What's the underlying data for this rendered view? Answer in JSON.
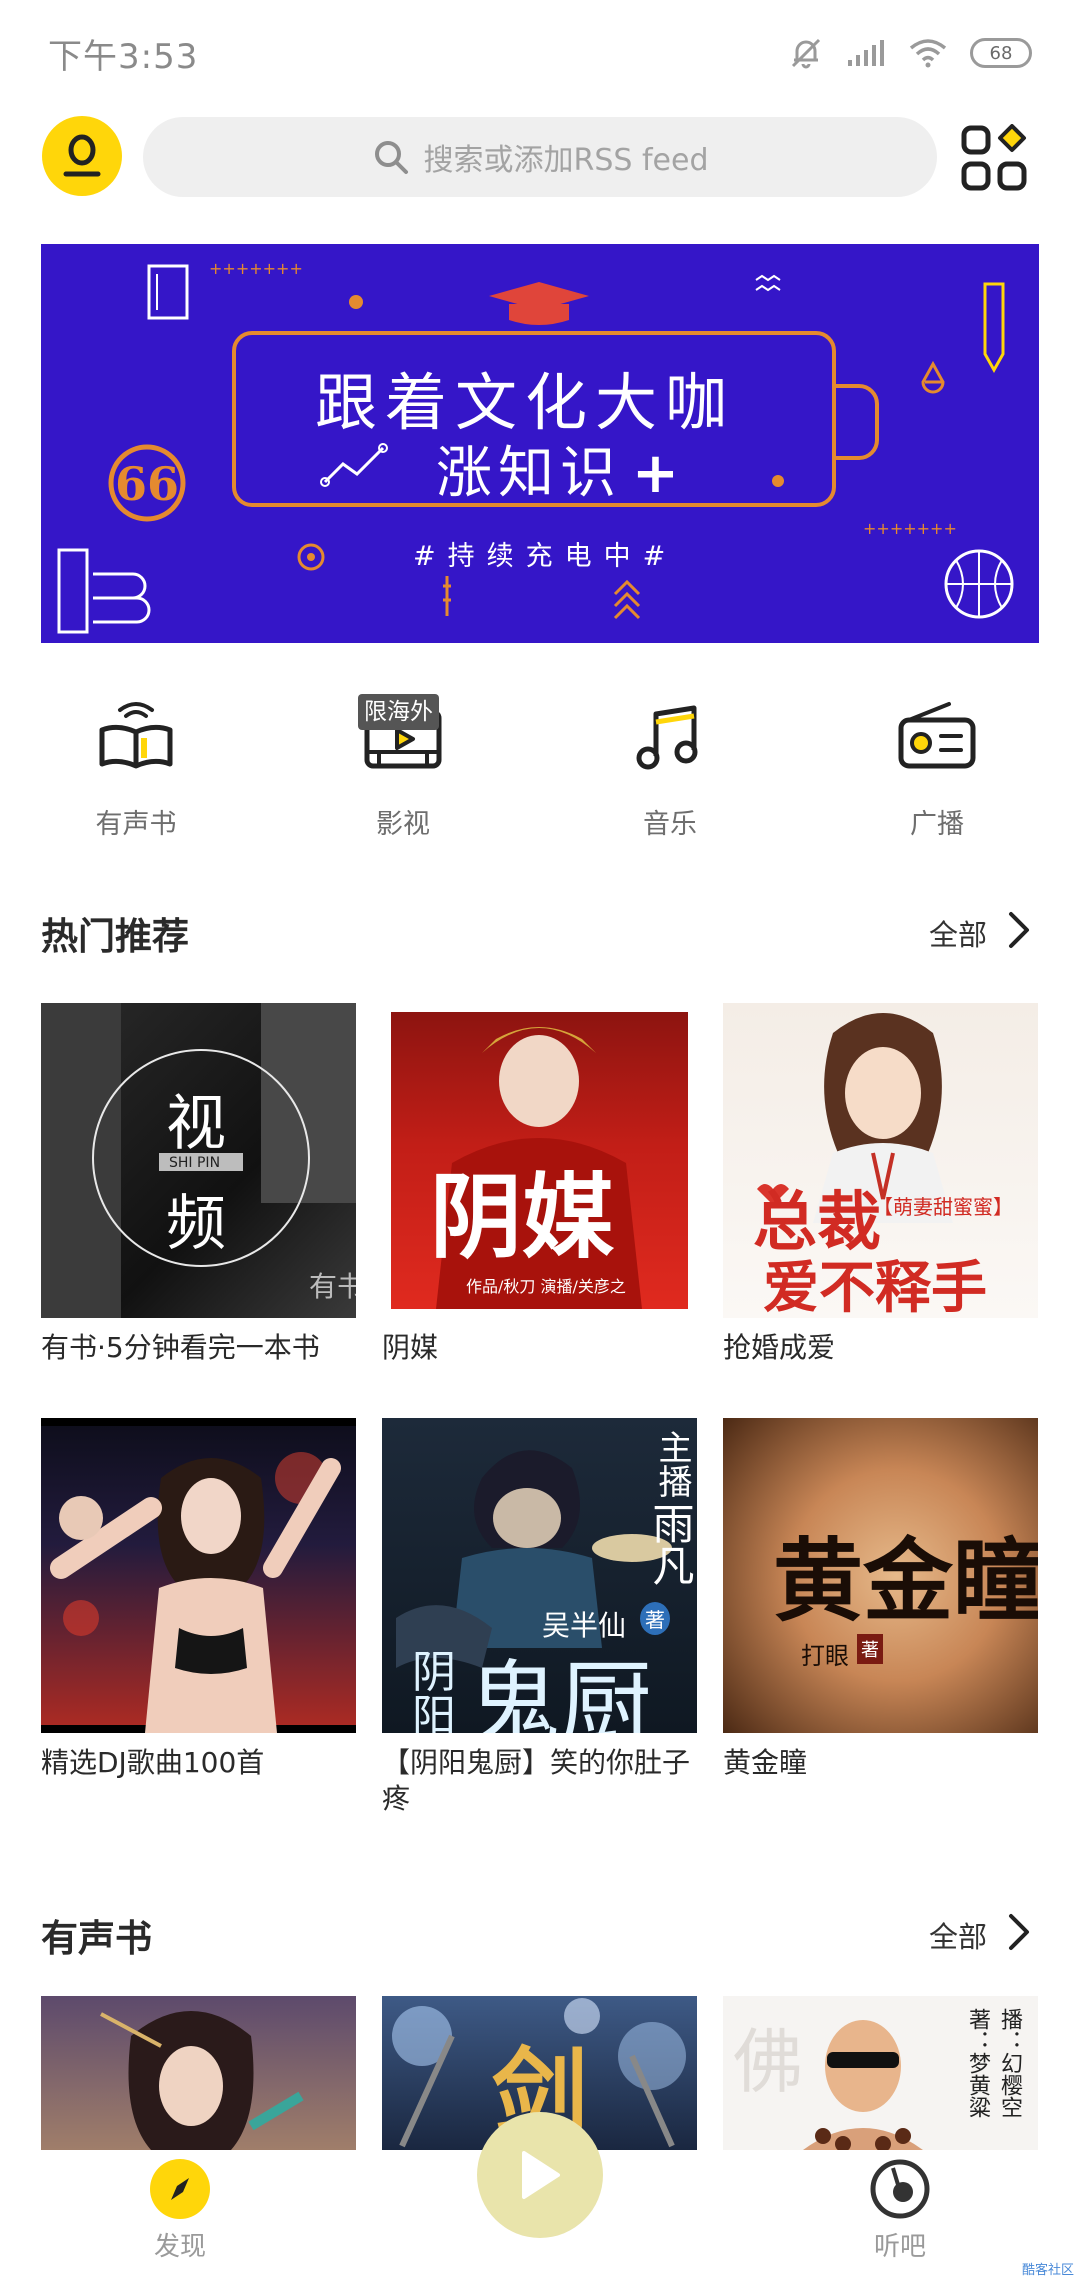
{
  "status_bar": {
    "time": "下午3:53",
    "battery": "68"
  },
  "search": {
    "placeholder": "搜索或添加RSS feed"
  },
  "banner": {
    "line1": "跟着文化大咖",
    "line2": "涨知识",
    "plus": "+",
    "tagline": "#持续充电中#"
  },
  "categories": [
    {
      "label": "有声书",
      "icon": "audiobook-icon"
    },
    {
      "label": "影视",
      "icon": "video-icon",
      "badge": "限海外"
    },
    {
      "label": "音乐",
      "icon": "music-note-icon"
    },
    {
      "label": "广播",
      "icon": "radio-icon"
    }
  ],
  "hot": {
    "title": "热门推荐",
    "more": "全部",
    "items": [
      {
        "title": "有书·5分钟看完一本书",
        "cover_text_1": "视",
        "cover_text_2": "频",
        "cover_sub": "SHI PIN",
        "cover_mark": "有书"
      },
      {
        "title": "阴媒",
        "cover_text": "阴媒",
        "cover_credit": "作品/秋刀  演播/关彦之"
      },
      {
        "title": "抢婚成爱",
        "cover_text_1": "总裁",
        "cover_text_2": "爱不释手",
        "cover_tag": "【萌妻甜蜜蜜】"
      },
      {
        "title": "精选DJ歌曲100首"
      },
      {
        "title": "【阴阳鬼厨】笑的你肚子疼",
        "cover_text_1": "阴",
        "cover_text_2": "阳",
        "cover_text_3": "鬼厨",
        "cover_side_1": "主播",
        "cover_side_2": "雨凡",
        "cover_author": "吴半仙",
        "cover_author_tag": "著"
      },
      {
        "title": "黄金瞳",
        "cover_text": "黄金瞳",
        "cover_author": "打眼",
        "cover_author_tag": "著"
      }
    ]
  },
  "audiobooks": {
    "title": "有声书",
    "more": "全部",
    "items": [
      {
        "cover_text": ""
      },
      {
        "cover_text": "剑"
      },
      {
        "cover_text_1": "著：梦黄粱",
        "cover_text_2": "播：幻樱空"
      }
    ]
  },
  "bottom_nav": {
    "discover": "发现",
    "listen": "听吧"
  },
  "watermark": "酷客社区",
  "colors": {
    "accent": "#ffd60a",
    "banner": "#3516c8",
    "banner_line": "#e58a2f",
    "fab": "#e9e4ab"
  }
}
